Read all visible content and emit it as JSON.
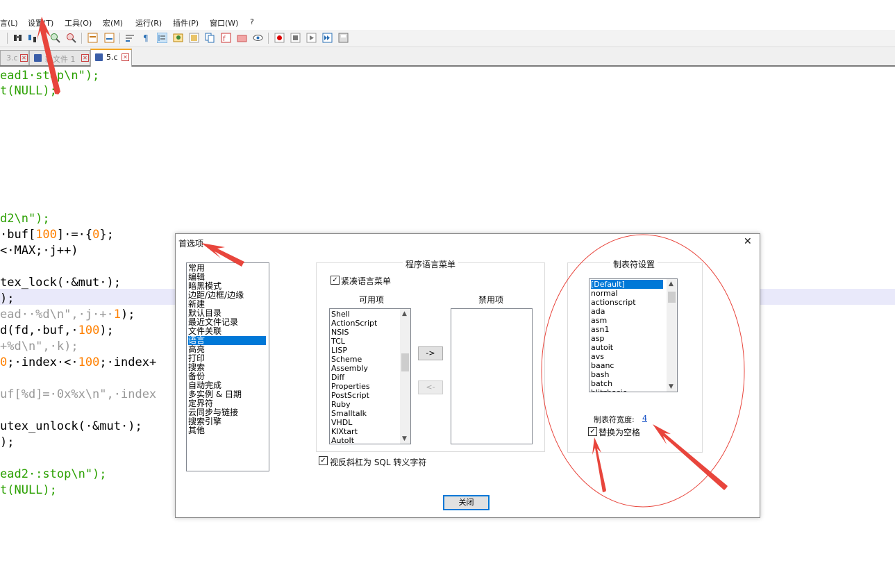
{
  "menubar": {
    "items": [
      "言(L)",
      "设置(T)",
      "工具(O)",
      "宏(M)",
      "运行(R)",
      "插件(P)",
      "窗口(W)",
      "?"
    ]
  },
  "toolbar": {
    "icons": [
      "find-icon",
      "replace-icon",
      "zoom-in-icon",
      "zoom-out-icon",
      "sync-v-icon",
      "sync-h-icon",
      "word-wrap-icon",
      "show-all-chars-icon",
      "indent-guide-icon",
      "udl-icon",
      "doc-map-icon",
      "doc-list-icon",
      "function-list-icon",
      "folder-workspace-icon",
      "monitor-icon",
      "record-macro-icon",
      "stop-record-icon",
      "play-macro-icon",
      "run-macro-multiple-icon",
      "save-macro-icon"
    ]
  },
  "tabs": [
    {
      "label": "3.c",
      "active": false
    },
    {
      "label": "新文件 1",
      "active": false
    },
    {
      "label": "5.c",
      "active": true
    }
  ],
  "code_lines": [
    {
      "segments": [
        {
          "t": "ead1·stop\\n\");",
          "c": "#2aa000"
        }
      ]
    },
    {
      "segments": [
        {
          "t": "t(NULL);",
          "c": "#2aa000"
        }
      ]
    },
    {
      "segments": [
        {
          "t": "d2\\n\");",
          "c": "#2aa000"
        }
      ]
    },
    {
      "segments": [
        {
          "t": "·buf[",
          "c": "#000"
        },
        {
          "t": "100",
          "c": "#ff8000"
        },
        {
          "t": "]·=·{",
          "c": "#000"
        },
        {
          "t": "0",
          "c": "#ff8000"
        },
        {
          "t": "};",
          "c": "#000"
        }
      ]
    },
    {
      "segments": [
        {
          "t": "<·MAX;·j++)",
          "c": "#000"
        }
      ]
    },
    {
      "segments": [
        {
          "t": "tex_lock(·&mut·);",
          "c": "#000"
        }
      ]
    },
    {
      "segments": [
        {
          "t": ");",
          "c": "#000"
        }
      ]
    },
    {
      "segments": [
        {
          "t": "ead··%d\\n\",·j·+·",
          "c": "#999"
        },
        {
          "t": "1",
          "c": "#ff8000"
        },
        {
          "t": ");",
          "c": "#000"
        }
      ]
    },
    {
      "segments": [
        {
          "t": "d(fd,·buf,·",
          "c": "#000"
        },
        {
          "t": "100",
          "c": "#ff8000"
        },
        {
          "t": ");",
          "c": "#000"
        }
      ]
    },
    {
      "segments": [
        {
          "t": "+%d\\n\",·k);",
          "c": "#999"
        }
      ]
    },
    {
      "segments": [
        {
          "t": "0",
          "c": "#ff8000"
        },
        {
          "t": ";·index·<·",
          "c": "#000"
        },
        {
          "t": "100",
          "c": "#ff8000"
        },
        {
          "t": ";·index+",
          "c": "#000"
        }
      ]
    },
    {
      "segments": [
        {
          "t": "uf[%d]=·0x%x\\n\",·index",
          "c": "#999"
        }
      ]
    },
    {
      "segments": [
        {
          "t": "utex_unlock(·&mut·);",
          "c": "#000"
        }
      ]
    },
    {
      "segments": [
        {
          "t": ");",
          "c": "#000"
        }
      ]
    },
    {
      "segments": [
        {
          "t": "ead2·:stop\\n\");",
          "c": "#2aa000"
        }
      ]
    },
    {
      "segments": [
        {
          "t": "t(NULL);",
          "c": "#2aa000"
        }
      ]
    }
  ],
  "dialog": {
    "title": "首选项",
    "close_glyph": "✕",
    "categories": [
      "常用",
      "编辑",
      "暗黑模式",
      "边距/边框/边缘",
      "新建",
      "默认目录",
      "最近文件记录",
      "文件关联",
      "语言",
      "高亮",
      "打印",
      "搜索",
      "备份",
      "自动完成",
      "多实例 & 日期",
      "定界符",
      "云同步与链接",
      "搜索引擎",
      "其他"
    ],
    "selected_category": "语言",
    "lang_menu": {
      "group_title": "程序语言菜单",
      "compact_checkbox_label": "紧凑语言菜单",
      "compact_checked": true,
      "available_header": "可用项",
      "disabled_header": "禁用项",
      "available_items": [
        "Shell",
        "ActionScript",
        "NSIS",
        "TCL",
        "LISP",
        "Scheme",
        "Assembly",
        "Diff",
        "Properties",
        "PostScript",
        "Ruby",
        "Smalltalk",
        "VHDL",
        "KIXtart",
        "AutoIt"
      ],
      "disabled_items": [],
      "move_right_label": "->",
      "move_left_label": "<-"
    },
    "tab_settings": {
      "group_title": "制表符设置",
      "languages": [
        "[Default]",
        "normal",
        "actionscript",
        "ada",
        "asm",
        "asn1",
        "asp",
        "autoit",
        "avs",
        "baanc",
        "bash",
        "batch",
        "blitzbasic"
      ],
      "selected_language": "[Default]",
      "tab_width_label": "制表符宽度:",
      "tab_width_value": "4",
      "replace_with_space_label": "替换为空格",
      "replace_checked": true
    },
    "sql_checkbox_label": "视反斜杠为 SQL 转义字符",
    "sql_checked": true,
    "close_button_label": "关闭"
  },
  "annotations": {
    "color": "#ff3b30"
  }
}
